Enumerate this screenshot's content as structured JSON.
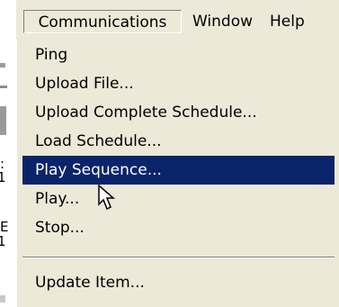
{
  "menubar": {
    "items": [
      {
        "label": "Communications"
      },
      {
        "label": "Window"
      },
      {
        "label": "Help"
      }
    ]
  },
  "menu": {
    "items": [
      {
        "label": "Ping"
      },
      {
        "label": "Upload File..."
      },
      {
        "label": "Upload Complete Schedule..."
      },
      {
        "label": "Load Schedule..."
      },
      {
        "label": "Play Sequence...",
        "highlighted": true
      },
      {
        "label": "Play..."
      },
      {
        "label": "Stop..."
      },
      {
        "label": "Update Item..."
      }
    ]
  },
  "background_fragments": {
    "glyph_1": ":",
    "glyph_2": "1",
    "glyph_3": "E",
    "glyph_4": "1"
  },
  "colors": {
    "menu_background": "#ece9d8",
    "highlight_background": "#0a246a",
    "highlight_text": "#ffffff"
  },
  "icons": {
    "cursor": "arrow-pointer-icon"
  }
}
